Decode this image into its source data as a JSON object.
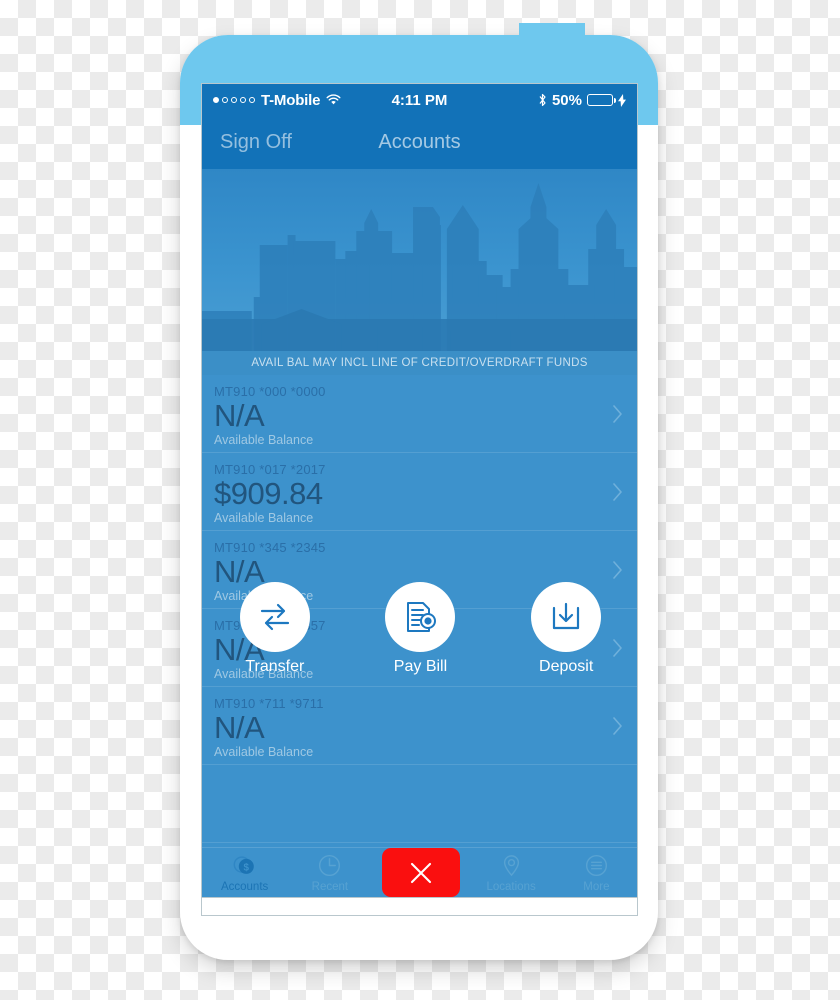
{
  "status_bar": {
    "signal_dots": 5,
    "signal_filled": 1,
    "carrier": "T-Mobile",
    "wifi_icon": "wifi-icon",
    "time": "4:11 PM",
    "bluetooth_icon": "bluetooth-icon",
    "battery_percent": "50%",
    "battery_level": 50,
    "charging_icon": "lightning-bolt-icon",
    "battery_color": "#4cd964"
  },
  "nav_bar": {
    "left_button": "Sign Off",
    "title": "Accounts"
  },
  "hero": {
    "alt": "city-skyline-banner"
  },
  "disclaimer": {
    "text": "AVAIL BAL MAY INCL LINE OF CREDIT/OVERDRAFT FUNDS"
  },
  "accounts": {
    "sub_label": "Available Balance",
    "chevron_icon": "chevron-right-icon",
    "rows": [
      {
        "number": "MT910 *000 *0000",
        "balance": "N/A"
      },
      {
        "number": "MT910 *017 *2017",
        "balance": "$909.84"
      },
      {
        "number": "MT910 *345 *2345",
        "balance": "N/A"
      },
      {
        "number": "MT910 *357 *6357",
        "balance": "N/A"
      },
      {
        "number": "MT910 *711 *9711",
        "balance": "N/A"
      }
    ]
  },
  "quick_actions": [
    {
      "label": "Transfer",
      "icon": "transfer-arrows-icon"
    },
    {
      "label": "Pay Bill",
      "icon": "document-coin-icon"
    },
    {
      "label": "Deposit",
      "icon": "download-tray-icon"
    }
  ],
  "tab_bar": {
    "tabs": [
      {
        "label": "Accounts",
        "icon": "coins-dollar-icon",
        "active": true
      },
      {
        "label": "Recent",
        "icon": "clock-icon",
        "active": false
      },
      {
        "label": "Locations",
        "icon": "map-pin-icon",
        "active": false
      },
      {
        "label": "More",
        "icon": "hamburger-circle-icon",
        "active": false
      }
    ],
    "close_button": {
      "icon": "close-x-icon",
      "color": "#fa0f0f"
    }
  },
  "theme": {
    "nav_blue": "#1272b8",
    "body_blue": "#3d92cc",
    "accent_red": "#fa0f0f",
    "battery_green": "#4cd964"
  }
}
